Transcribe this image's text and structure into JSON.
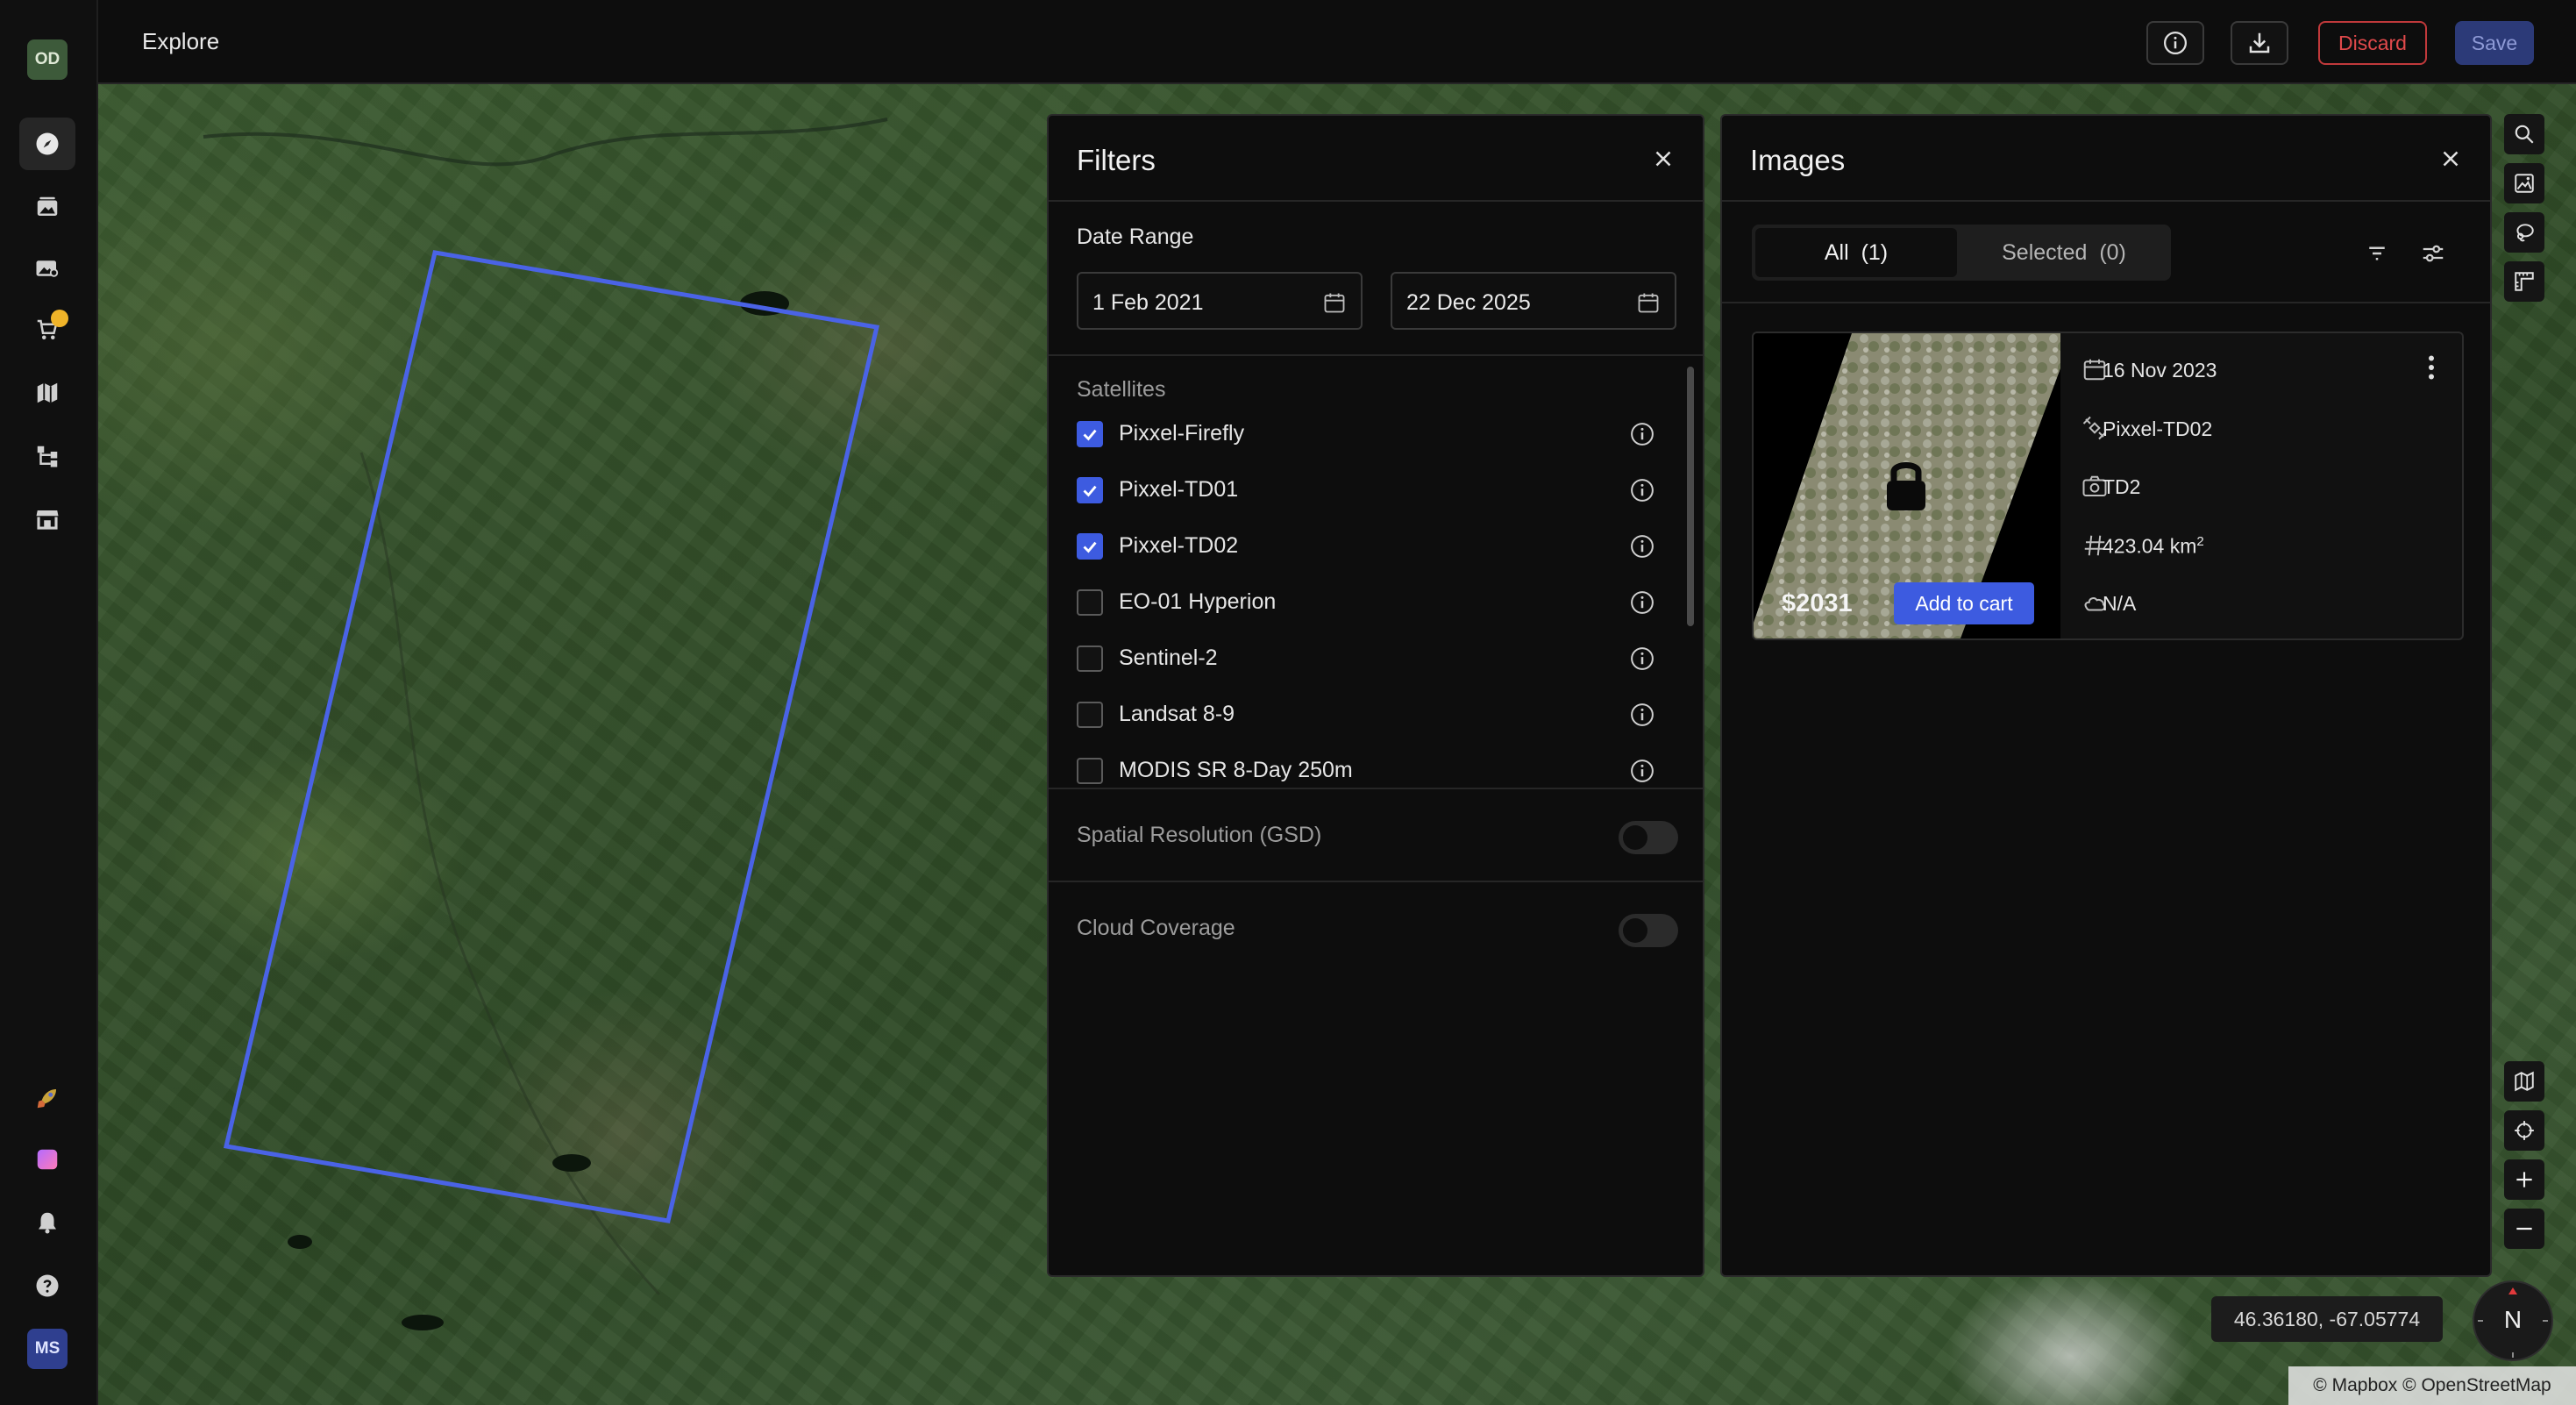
{
  "app": {
    "page_title": "Explore",
    "user_initials_top": "OD",
    "user_initials_bottom": "MS"
  },
  "sidebar": {
    "items": [
      {
        "name": "explore-nav",
        "icon": "compass-icon",
        "active": true
      },
      {
        "name": "gallery-nav",
        "icon": "images-icon"
      },
      {
        "name": "catalog-nav",
        "icon": "image-search-icon"
      },
      {
        "name": "cart-nav",
        "icon": "cart-icon",
        "badge": true
      },
      {
        "name": "map-nav",
        "icon": "map-icon"
      },
      {
        "name": "workflow-nav",
        "icon": "workflow-icon"
      },
      {
        "name": "store-nav",
        "icon": "store-icon"
      }
    ],
    "bottom_items": [
      {
        "name": "launch-nav",
        "icon": "rocket-icon"
      },
      {
        "name": "app-nav",
        "icon": "gradient-app-icon"
      },
      {
        "name": "notifications-nav",
        "icon": "bell-icon"
      },
      {
        "name": "help-nav",
        "icon": "help-icon"
      }
    ]
  },
  "toolbar": {
    "discard_label": "Discard",
    "save_label": "Save"
  },
  "filters": {
    "title": "Filters",
    "date_range_label": "Date Range",
    "start_date": "1 Feb 2021",
    "end_date": "22 Dec 2025",
    "satellites_label": "Satellites",
    "satellites": [
      {
        "label": "Pixxel-Firefly",
        "checked": true
      },
      {
        "label": "Pixxel-TD01",
        "checked": true
      },
      {
        "label": "Pixxel-TD02",
        "checked": true
      },
      {
        "label": "EO-01 Hyperion",
        "checked": false
      },
      {
        "label": "Sentinel-2",
        "checked": false
      },
      {
        "label": "Landsat 8-9",
        "checked": false
      },
      {
        "label": "MODIS SR 8-Day 250m",
        "checked": false
      }
    ],
    "gsd_label": "Spatial Resolution (GSD)",
    "gsd_enabled": false,
    "cloud_label": "Cloud Coverage",
    "cloud_enabled": false
  },
  "images": {
    "title": "Images",
    "tab_all": "All",
    "tab_all_count": "(1)",
    "tab_selected": "Selected",
    "tab_selected_count": "(0)",
    "items": [
      {
        "price": "$2031",
        "add_to_cart": "Add to cart",
        "date": "16 Nov 2023",
        "satellite": "Pixxel-TD02",
        "sensor": "TD2",
        "area": "423.04 km",
        "area_unit_sup": "2",
        "cloud": "N/A"
      }
    ]
  },
  "map": {
    "coordinates": "46.36180, -67.05774",
    "compass_label": "N",
    "attribution": "© Mapbox © OpenStreetMap",
    "footprint_color": "#4a63e6"
  },
  "colors": {
    "accent": "#3d5be0",
    "danger": "#e0494b",
    "badge": "#f0b429"
  }
}
